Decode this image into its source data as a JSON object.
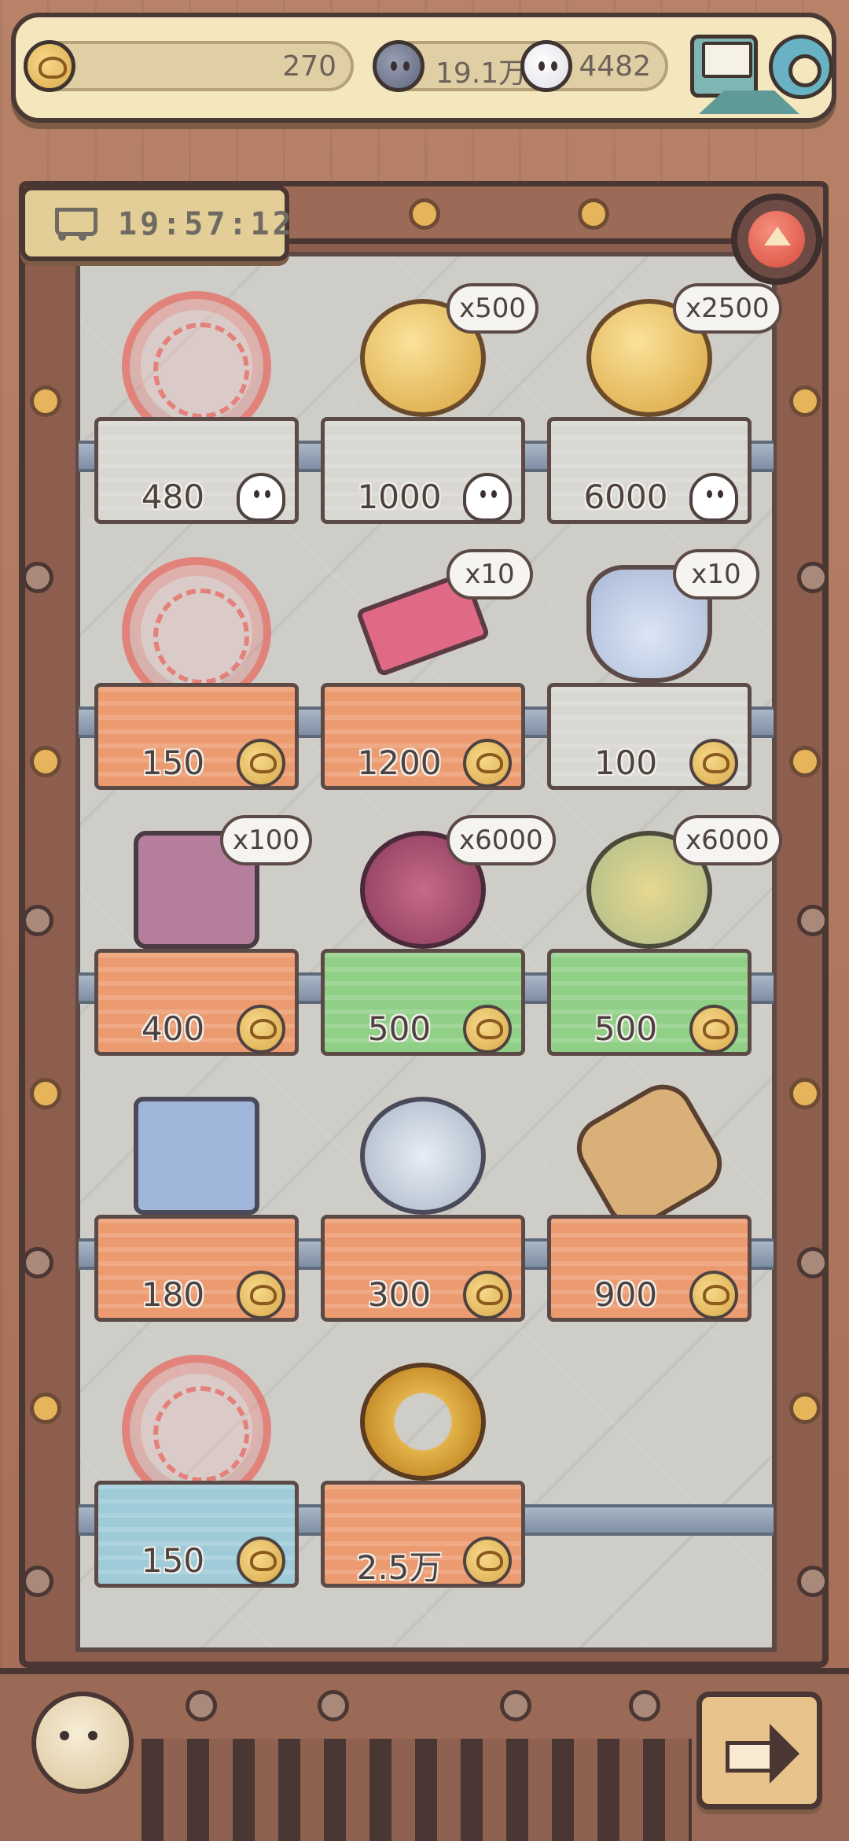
{
  "resources": {
    "coins": "270",
    "dark_ghosts": "19.1万",
    "light_ghosts": "4482"
  },
  "timer": "19:57:12",
  "shelves": [
    [
      {
        "art": "art-sold-generic",
        "sold": true,
        "qty": "",
        "price": "480",
        "currency": "ghost",
        "tag": "tag-white"
      },
      {
        "art": "art-gold-coin",
        "sold": false,
        "qty": "x500",
        "price": "1000",
        "currency": "ghost",
        "tag": "tag-white"
      },
      {
        "art": "art-gold-coin",
        "sold": false,
        "qty": "x2500",
        "price": "6000",
        "currency": "ghost",
        "tag": "tag-white"
      }
    ],
    [
      {
        "art": "art-sold-generic",
        "sold": true,
        "qty": "",
        "price": "150",
        "currency": "coin",
        "tag": "tag-orange"
      },
      {
        "art": "art-ticket",
        "sold": false,
        "qty": "x10",
        "price": "1200",
        "currency": "coin",
        "tag": "tag-orange"
      },
      {
        "art": "art-potion",
        "sold": false,
        "qty": "x10",
        "price": "100",
        "currency": "coin",
        "tag": "tag-white"
      }
    ],
    [
      {
        "art": "art-chest",
        "sold": false,
        "qty": "x100",
        "price": "400",
        "currency": "coin",
        "tag": "tag-orange"
      },
      {
        "art": "art-urchin-pink",
        "sold": false,
        "qty": "x6000",
        "price": "500",
        "currency": "coin",
        "tag": "tag-green"
      },
      {
        "art": "art-urchin-yellow",
        "sold": false,
        "qty": "x6000",
        "price": "500",
        "currency": "coin",
        "tag": "tag-green"
      }
    ],
    [
      {
        "art": "art-basket",
        "sold": false,
        "qty": "",
        "price": "180",
        "currency": "coin",
        "tag": "tag-orange"
      },
      {
        "art": "art-bowl",
        "sold": false,
        "qty": "",
        "price": "300",
        "currency": "coin",
        "tag": "tag-orange"
      },
      {
        "art": "art-scroll",
        "sold": false,
        "qty": "",
        "price": "900",
        "currency": "coin",
        "tag": "tag-orange"
      }
    ],
    [
      {
        "art": "art-sold-generic",
        "sold": true,
        "qty": "",
        "price": "150",
        "currency": "coin",
        "tag": "tag-blue"
      },
      {
        "art": "art-ring",
        "sold": false,
        "qty": "",
        "price": "2.5万",
        "currency": "coin",
        "tag": "tag-orange"
      }
    ]
  ],
  "icons": {
    "coin": "coin-icon",
    "dark_ghost": "dark-ghost-icon",
    "light_ghost": "light-ghost-icon",
    "mail": "mail-icon",
    "settings": "gear-icon",
    "cart": "cart-icon",
    "collapse": "triangle-up-icon",
    "next": "arrow-right-icon",
    "avatar": "avatar-icon"
  },
  "colors": {
    "accent_red": "#d94b3c",
    "tag_orange": "#ec9a6f",
    "tag_green": "#8fcf86",
    "tag_white": "#d9d7d2",
    "tag_blue": "#9fcbd8"
  }
}
